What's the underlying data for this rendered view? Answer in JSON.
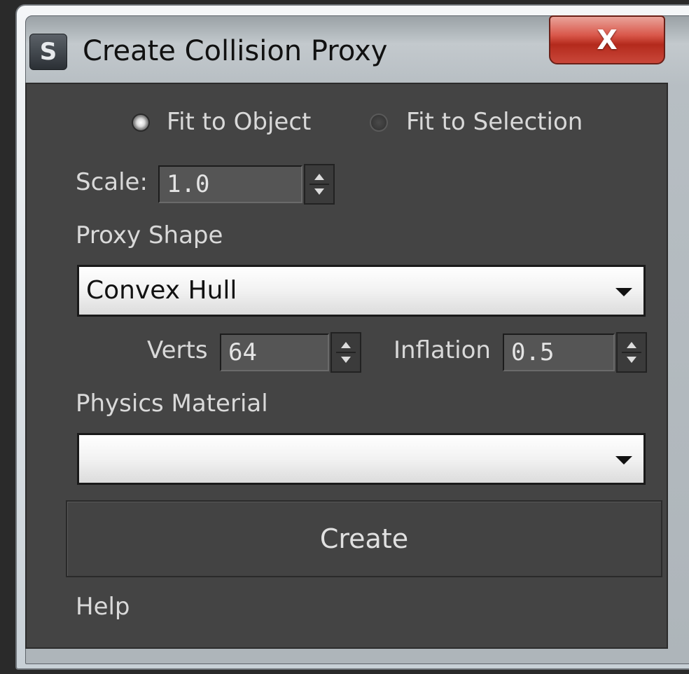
{
  "window": {
    "title": "Create Collision Proxy",
    "close_glyph": "X",
    "app_icon_glyph": "S",
    "app_icon": "3dsmax-logo-icon"
  },
  "fit_mode": {
    "options": [
      "Fit to Object",
      "Fit to Selection"
    ],
    "selected": "Fit to Object"
  },
  "scale": {
    "label": "Scale:",
    "value": "1.0"
  },
  "proxy_shape": {
    "label": "Proxy Shape",
    "selected": "Convex Hull"
  },
  "verts": {
    "label": "Verts",
    "value": "64"
  },
  "inflation": {
    "label": "Inflation",
    "value": "0.5"
  },
  "physics_material": {
    "label": "Physics Material",
    "selected": ""
  },
  "create_button": "Create",
  "help_link": "Help",
  "colors": {
    "panel_bg": "#444444",
    "text": "#d9d9d9",
    "close_red": "#c9473a"
  }
}
